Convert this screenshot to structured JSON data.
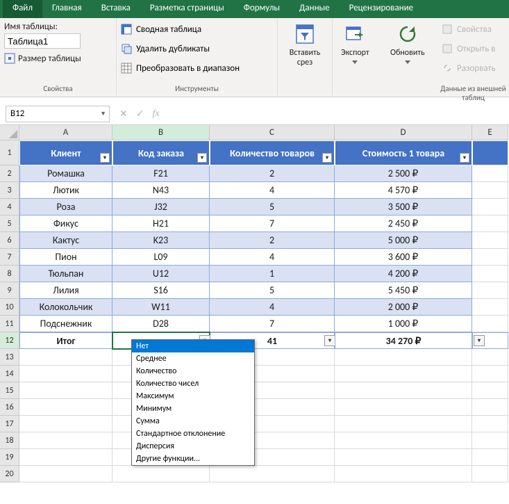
{
  "tabs": [
    "Файл",
    "Главная",
    "Вставка",
    "Разметка страницы",
    "Формулы",
    "Данные",
    "Рецензирование"
  ],
  "ribbon": {
    "props": {
      "name_label": "Имя таблицы:",
      "name_value": "Таблица1",
      "resize": "Размер таблицы",
      "group": "Свойства"
    },
    "tools": {
      "pivot": "Сводная таблица",
      "dedup": "Удалить дубликаты",
      "convert": "Преобразовать в диапазон",
      "group": "Инструменты"
    },
    "slicer": {
      "label": "Вставить срез"
    },
    "export": {
      "label": "Экспорт"
    },
    "refresh": {
      "label": "Обновить"
    },
    "extern": {
      "props": "Свойства",
      "open": "Открыть в",
      "unlink": "Разорвать",
      "group": "Данные из внешней таблиц"
    }
  },
  "namebox": "B12",
  "colheads": [
    "A",
    "B",
    "C",
    "D",
    "E"
  ],
  "table": {
    "headers": [
      "Клиент",
      "Код заказа",
      "Количество товаров",
      "Стоимость 1 товара"
    ],
    "rows": [
      [
        "Ромашка",
        "F21",
        "2",
        "2 500 ₽"
      ],
      [
        "Лютик",
        "N43",
        "4",
        "4 570 ₽"
      ],
      [
        "Роза",
        "J32",
        "5",
        "3 500 ₽"
      ],
      [
        "Фикус",
        "H21",
        "7",
        "2 450 ₽"
      ],
      [
        "Кактус",
        "K23",
        "2",
        "5 000 ₽"
      ],
      [
        "Пион",
        "L09",
        "4",
        "3 600 ₽"
      ],
      [
        "Тюльпан",
        "U12",
        "1",
        "4 200 ₽"
      ],
      [
        "Лилия",
        "S16",
        "5",
        "5 450 ₽"
      ],
      [
        "Колокольчик",
        "W11",
        "4",
        "2 000 ₽"
      ],
      [
        "Подснежник",
        "D28",
        "7",
        "1 000 ₽"
      ]
    ],
    "total": {
      "label": "Итог",
      "b": "",
      "c": "41",
      "d": "34 270 ₽"
    }
  },
  "dropdown": {
    "items": [
      "Нет",
      "Среднее",
      "Количество",
      "Количество чисел",
      "Максимум",
      "Минимум",
      "Сумма",
      "Стандартное отклонение",
      "Дисперсия",
      "Другие функции..."
    ],
    "selected": 0
  }
}
